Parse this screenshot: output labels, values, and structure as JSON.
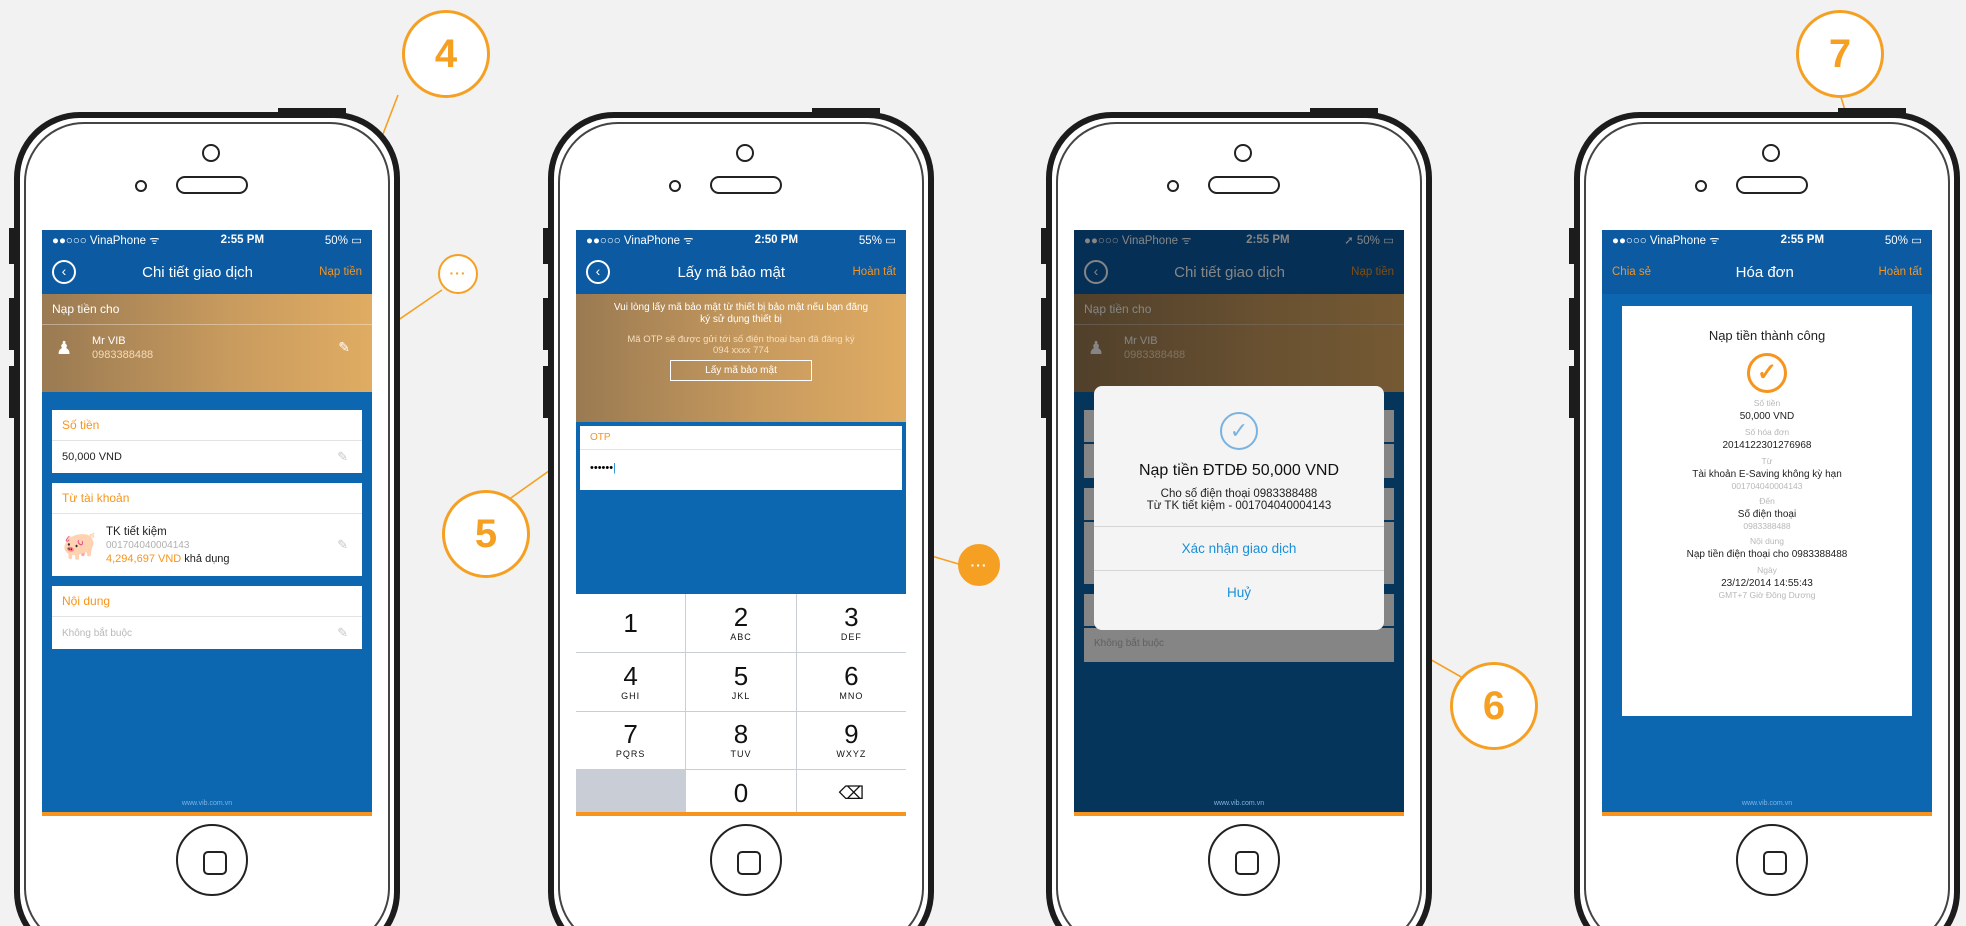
{
  "callouts": {
    "c4": "4",
    "c5": "5",
    "c6": "6",
    "c7": "7",
    "more": "···"
  },
  "colors": {
    "accent": "#f7941d",
    "primary": "#0b5aa2",
    "link": "#1a8fd8"
  },
  "phone1": {
    "status": {
      "carrier": "●●○○○ VinaPhone ᯤ",
      "time": "2:55 PM",
      "battery": "50% ▭"
    },
    "nav": {
      "title": "Chi tiết giao dịch",
      "action": "Nạp tiền"
    },
    "recipient_header": "Nạp tiền cho",
    "recipient": {
      "name": "Mr VIB",
      "phone": "0983388488"
    },
    "amount": {
      "label": "Số tiền",
      "value": "50,000 VND"
    },
    "from_account": {
      "label": "Từ tài khoản",
      "name": "TK tiết kiệm",
      "number": "001704040004143",
      "balance": "4,294,697 VND",
      "balance_note": "khả dụng"
    },
    "content": {
      "label": "Nội dung",
      "placeholder": "Không bắt buộc"
    },
    "footer": "www.vib.com.vn"
  },
  "phone2": {
    "status": {
      "carrier": "●●○○○ VinaPhone ᯤ",
      "time": "2:50 PM",
      "battery": "55% ▭"
    },
    "nav": {
      "title": "Lấy mã bảo mật",
      "action": "Hoàn tất"
    },
    "instruction": "Vui lòng lấy mã bảo mật từ thiết bị bảo mật nếu bạn đăng ký sử dụng thiết bị",
    "otp_note": "Mã OTP sẽ được gửi tới số điện thoại bạn đã đăng ký",
    "otp_phone": "094 xxxx 774",
    "get_code_button": "Lấy mã bảo mật",
    "otp_label": "OTP",
    "otp_value": "••••••",
    "keys": [
      {
        "n": "1",
        "l": ""
      },
      {
        "n": "2",
        "l": "ABC"
      },
      {
        "n": "3",
        "l": "DEF"
      },
      {
        "n": "4",
        "l": "GHI"
      },
      {
        "n": "5",
        "l": "JKL"
      },
      {
        "n": "6",
        "l": "MNO"
      },
      {
        "n": "7",
        "l": "PQRS"
      },
      {
        "n": "8",
        "l": "TUV"
      },
      {
        "n": "9",
        "l": "WXYZ"
      },
      {
        "n": "",
        "l": ""
      },
      {
        "n": "0",
        "l": ""
      },
      {
        "n": "⌫",
        "l": ""
      }
    ]
  },
  "phone3": {
    "status": {
      "carrier": "●●○○○ VinaPhone ᯤ",
      "time": "2:55 PM",
      "battery": "➚ 50% ▭"
    },
    "nav": {
      "title": "Chi tiết giao dịch",
      "action": "Nạp tiền"
    },
    "recipient_header": "Nạp tiền cho",
    "recipient": {
      "name": "Mr VIB",
      "phone": "0983388488"
    },
    "content_placeholder": "Không bắt buộc",
    "dialog": {
      "title": "Nạp tiền ĐTDĐ 50,000 VND",
      "line1": "Cho số điện thoại 0983388488",
      "line2": "Từ TK tiết kiệm - 001704040004143",
      "confirm": "Xác nhận giao dịch",
      "cancel": "Huỷ"
    },
    "footer": "www.vib.com.vn"
  },
  "phone4": {
    "status": {
      "carrier": "●●○○○ VinaPhone ᯤ",
      "time": "2:55 PM",
      "battery": "50% ▭"
    },
    "nav": {
      "left": "Chia sẻ",
      "title": "Hóa đơn",
      "action": "Hoàn tất"
    },
    "receipt": {
      "title": "Nạp tiền thành công",
      "amount_label": "Số tiền",
      "amount": "50,000 VND",
      "invoice_label": "Số hóa đơn",
      "invoice": "2014122301276968",
      "from_label": "Từ",
      "from": "Tài khoản E-Saving không kỳ hạn",
      "from_number": "001704040004143",
      "to_label": "Đến",
      "to": "Số điện thoại",
      "to_number": "0983388488",
      "content_label": "Nội dung",
      "content": "Nạp tiền điện thoại cho 0983388488",
      "date_label": "Ngày",
      "date": "23/12/2014 14:55:43",
      "timezone": "GMT+7 Giờ Đông Dương"
    },
    "footer": "www.vib.com.vn"
  }
}
